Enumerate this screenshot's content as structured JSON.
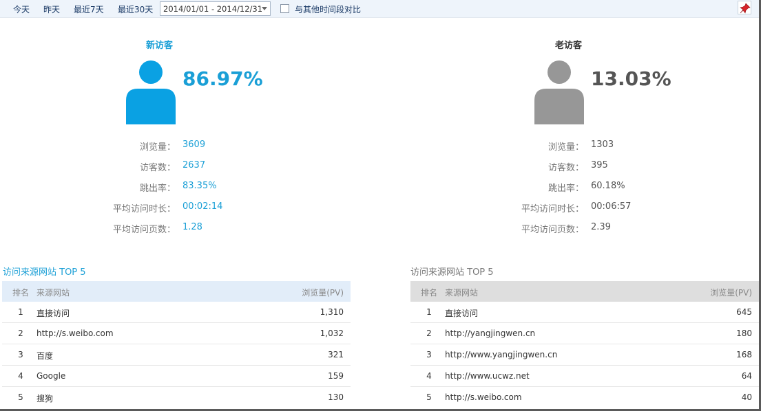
{
  "toolbar": {
    "today": "今天",
    "yesterday": "昨天",
    "last7": "最近7天",
    "last30": "最近30天",
    "date_range": "2014/01/01 - 2014/12/31",
    "compare_label": "与其他时间段对比"
  },
  "new_visitors": {
    "title": "新访客",
    "percent": "86.97%",
    "color": "#1a9fd6",
    "avatar_color": "#0aa1e3",
    "stats": [
      {
        "label": "浏览量：",
        "value": "3609"
      },
      {
        "label": "访客数：",
        "value": "2637"
      },
      {
        "label": "跳出率：",
        "value": "83.35%"
      },
      {
        "label": "平均访问时长：",
        "value": "00:02:14"
      },
      {
        "label": "平均访问页数：",
        "value": "1.28"
      }
    ]
  },
  "old_visitors": {
    "title": "老访客",
    "percent": "13.03%",
    "color": "#555555",
    "avatar_color": "#979797",
    "stats": [
      {
        "label": "浏览量：",
        "value": "1303"
      },
      {
        "label": "访客数：",
        "value": "395"
      },
      {
        "label": "跳出率：",
        "value": "60.18%"
      },
      {
        "label": "平均访问时长：",
        "value": "00:06:57"
      },
      {
        "label": "平均访问页数：",
        "value": "2.39"
      }
    ]
  },
  "new_sources": {
    "title": "访问来源网站 TOP 5",
    "headers": {
      "rank": "排名",
      "site": "来源网站",
      "pv": "浏览量(PV)"
    },
    "header_color": "#e2edf9",
    "rows": [
      {
        "rank": "1",
        "site": "直接访问",
        "pv": "1,310"
      },
      {
        "rank": "2",
        "site": "http://s.weibo.com",
        "pv": "1,032"
      },
      {
        "rank": "3",
        "site": "百度",
        "pv": "321"
      },
      {
        "rank": "4",
        "site": "Google",
        "pv": "159"
      },
      {
        "rank": "5",
        "site": "搜狗",
        "pv": "130"
      }
    ]
  },
  "old_sources": {
    "title": "访问来源网站 TOP 5",
    "headers": {
      "rank": "排名",
      "site": "来源网站",
      "pv": "浏览量(PV)"
    },
    "header_color": "#dedede",
    "rows": [
      {
        "rank": "1",
        "site": "直接访问",
        "pv": "645"
      },
      {
        "rank": "2",
        "site": "http://yangjingwen.cn",
        "pv": "180"
      },
      {
        "rank": "3",
        "site": "http://www.yangjingwen.cn",
        "pv": "168"
      },
      {
        "rank": "4",
        "site": "http://www.ucwz.net",
        "pv": "64"
      },
      {
        "rank": "5",
        "site": "http://s.weibo.com",
        "pv": "40"
      }
    ]
  }
}
